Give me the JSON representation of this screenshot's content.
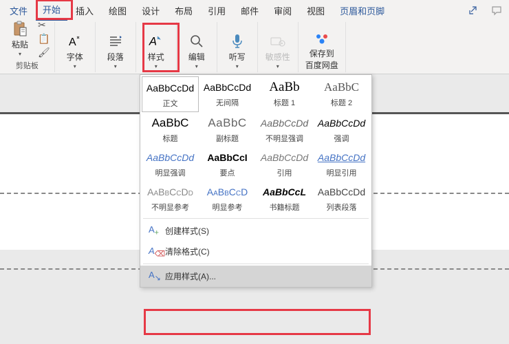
{
  "menu": {
    "file": "文件",
    "home": "开始",
    "insert": "插入",
    "draw": "绘图",
    "design": "设计",
    "layout": "布局",
    "references": "引用",
    "mailings": "邮件",
    "review": "审阅",
    "view": "视图",
    "header_footer": "页眉和页脚"
  },
  "ribbon": {
    "paste": "粘贴",
    "clipboard_label": "剪贴板",
    "font": "字体",
    "paragraph": "段落",
    "styles": "样式",
    "editing": "编辑",
    "dictate": "听写",
    "sensitivity": "敏感性",
    "save_baidu_line1": "保存到",
    "save_baidu_line2": "百度网盘"
  },
  "styles_panel": {
    "grid": [
      {
        "preview": "AaBbCcDd",
        "label": "正文",
        "cls": ""
      },
      {
        "preview": "AaBbCcDd",
        "label": "无间隔",
        "cls": ""
      },
      {
        "preview": "AaBb",
        "label": "标题 1",
        "cls": "sp-h1"
      },
      {
        "preview": "AaBbC",
        "label": "标题 2",
        "cls": "sp-h2"
      },
      {
        "preview": "AaBbC",
        "label": "标题",
        "cls": "sp-title"
      },
      {
        "preview": "AaBbC",
        "label": "副标题",
        "cls": "sp-sub"
      },
      {
        "preview": "AaBbCcDd",
        "label": "不明显强调",
        "cls": "sp-weak-em"
      },
      {
        "preview": "AaBbCcDd",
        "label": "强调",
        "cls": "sp-em"
      },
      {
        "preview": "AaBbCcDd",
        "label": "明显强调",
        "cls": "sp-strong-em"
      },
      {
        "preview": "AaBbCcI",
        "label": "要点",
        "cls": "sp-key"
      },
      {
        "preview": "AaBbCcDd",
        "label": "引用",
        "cls": "sp-quote"
      },
      {
        "preview": "AaBbCcDd",
        "label": "明显引用",
        "cls": "sp-strong-quote"
      },
      {
        "preview": "AaBbCcDd",
        "label": "不明显参考",
        "cls": "sp-weak-ref"
      },
      {
        "preview": "AaBbCcD",
        "label": "明显参考",
        "cls": "sp-strong-ref"
      },
      {
        "preview": "AaBbCcL",
        "label": "书籍标题",
        "cls": "sp-book"
      },
      {
        "preview": "AaBbCcDd",
        "label": "列表段落",
        "cls": "sp-list"
      }
    ],
    "create_style": "创建样式(S)",
    "clear_formatting": "清除格式(C)",
    "apply_styles": "应用样式(A)..."
  }
}
